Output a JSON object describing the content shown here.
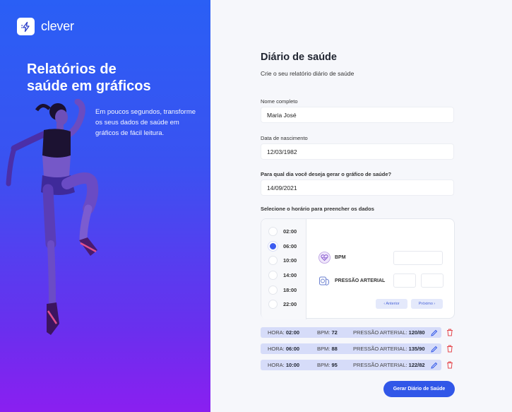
{
  "brand": {
    "name": "clever",
    "icon": "lightning-bolt-icon"
  },
  "hero": {
    "line1": "Relatórios de",
    "line2": "saúde em gráficos",
    "blurb": "Em poucos segundos, transforme os seus dados de saúde em gráficos de fácil leitura."
  },
  "form": {
    "title": "Diário de saúde",
    "subtitle": "Crie o seu relatório diário de saúde",
    "name_label": "Nome completo",
    "name_value": "Maria José",
    "birth_label": "Data de nascimento",
    "birth_value": "12/03/1982",
    "date_question": "Para qual dia você deseja gerar o gráfico de saúde?",
    "date_value": "14/09/2021",
    "time_instruction": "Selecione o horário para preencher os dados"
  },
  "times": [
    {
      "label": "02:00",
      "selected": false
    },
    {
      "label": "06:00",
      "selected": true
    },
    {
      "label": "10:00",
      "selected": false
    },
    {
      "label": "14:00",
      "selected": false
    },
    {
      "label": "18:00",
      "selected": false
    },
    {
      "label": "22:00",
      "selected": false
    }
  ],
  "metrics": {
    "bpm_label": "BPM",
    "bpm_icon": "heart-pulse-icon",
    "pressure_label": "PRESSÃO ARTERIAL",
    "pressure_icon": "blood-pressure-icon",
    "prev_label": "‹ Anterior",
    "next_label": "Próximo ›"
  },
  "records": [
    {
      "hora_label": "HORA:",
      "hora": "02:00",
      "bpm_label": "BPM:",
      "bpm": "72",
      "pa_label": "PRESSÃO ARTERIAL:",
      "pa": "120/80"
    },
    {
      "hora_label": "HORA:",
      "hora": "06:00",
      "bpm_label": "BPM:",
      "bpm": "88",
      "pa_label": "PRESSÃO ARTERIAL:",
      "pa": "135/90"
    },
    {
      "hora_label": "HORA:",
      "hora": "10:00",
      "bpm_label": "BPM:",
      "bpm": "95",
      "pa_label": "PRESSÃO ARTERIAL:",
      "pa": "122/82"
    }
  ],
  "cta_label": "Gerar Diário de Saúde",
  "colors": {
    "accent": "#3157e8",
    "gradient_top": "#2a5ff5",
    "gradient_bottom": "#8a1ff0",
    "row_bg": "#d6dcf9",
    "delete": "#e5484d"
  }
}
